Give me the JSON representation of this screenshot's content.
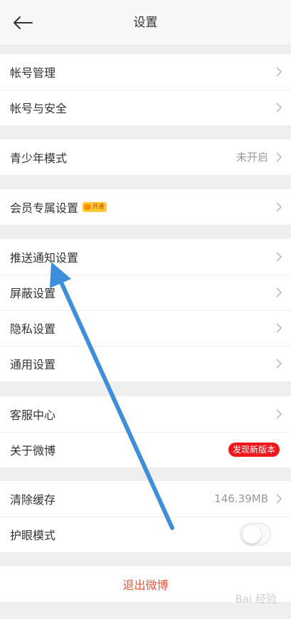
{
  "header": {
    "title": "设置",
    "back_icon": "arrow-left-icon"
  },
  "groups": {
    "account": {
      "items": [
        {
          "label": "帐号管理"
        },
        {
          "label": "帐号与安全"
        }
      ]
    },
    "youth": {
      "items": [
        {
          "label": "青少年模式",
          "value": "未开启"
        }
      ]
    },
    "vip": {
      "items": [
        {
          "label": "会员专属设置",
          "badge": "开通"
        }
      ]
    },
    "settings": {
      "items": [
        {
          "label": "推送通知设置"
        },
        {
          "label": "屏蔽设置"
        },
        {
          "label": "隐私设置"
        },
        {
          "label": "通用设置"
        }
      ]
    },
    "about": {
      "items": [
        {
          "label": "客服中心"
        },
        {
          "label": "关于微博",
          "badge": "发现新版本"
        }
      ]
    },
    "misc": {
      "items": [
        {
          "label": "清除缓存",
          "value": "146.39MB"
        },
        {
          "label": "护眼模式",
          "toggle": false
        }
      ]
    },
    "logout": {
      "label": "退出微博"
    }
  },
  "colors": {
    "arrow": "#3d8fdb",
    "danger": "#f0161a",
    "logout_text": "#e8563a"
  },
  "watermark": "Bai 经验"
}
